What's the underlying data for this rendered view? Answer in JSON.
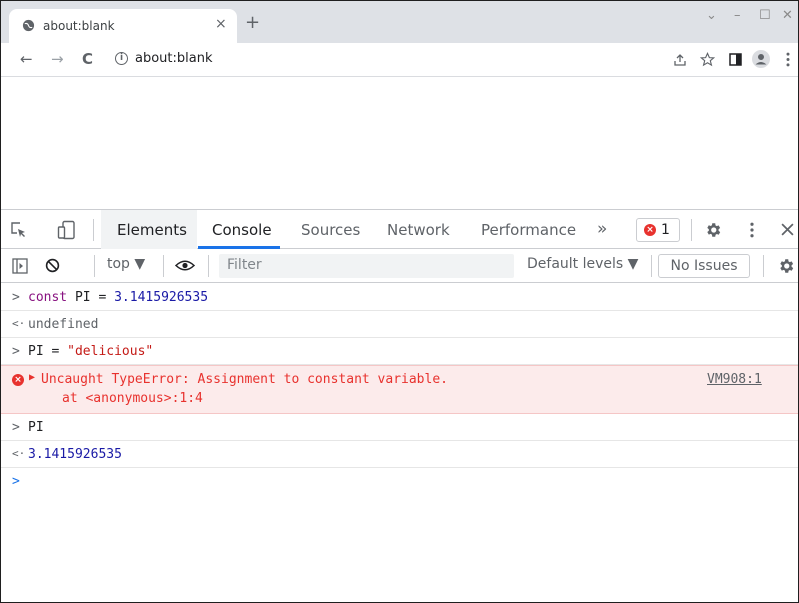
{
  "browser": {
    "tab": {
      "title": "about:blank",
      "close": "×"
    },
    "new_tab": "+",
    "window_buttons": {
      "dropdown": "⌄",
      "minimize": "–",
      "maximize": "☐",
      "close": "✕"
    },
    "nav": {
      "back": "←",
      "forward": "→",
      "reload": "C"
    },
    "url": "about:blank",
    "info_icon": "i"
  },
  "devtools": {
    "tabs": [
      "Elements",
      "Console",
      "Sources",
      "Network",
      "Performance"
    ],
    "more": "»",
    "error_count": "1",
    "error_glyph": "×",
    "console": {
      "context": "top ▼",
      "filter_placeholder": "Filter",
      "levels": "Default levels ▼",
      "issues": "No Issues"
    },
    "lines": {
      "l1": {
        "keyword": "const",
        "rest": " PI = ",
        "number": "3.1415926535"
      },
      "l2": {
        "text": "undefined"
      },
      "l3": {
        "rest": "PI = ",
        "string": "\"delicious\""
      },
      "error": {
        "message": "Uncaught TypeError: Assignment to constant variable.",
        "trace": "at <anonymous>:1:4",
        "source": "VM908:1"
      },
      "l5": {
        "text": "PI"
      },
      "l6": {
        "number": "3.1415926535"
      }
    },
    "prompt_symbols": {
      "input": ">",
      "output": "<·"
    }
  },
  "colors": {
    "accent": "#1a73e8",
    "error": "#e8322e",
    "number": "#1a1aa6",
    "string": "#c41a16",
    "keyword": "#881280"
  }
}
